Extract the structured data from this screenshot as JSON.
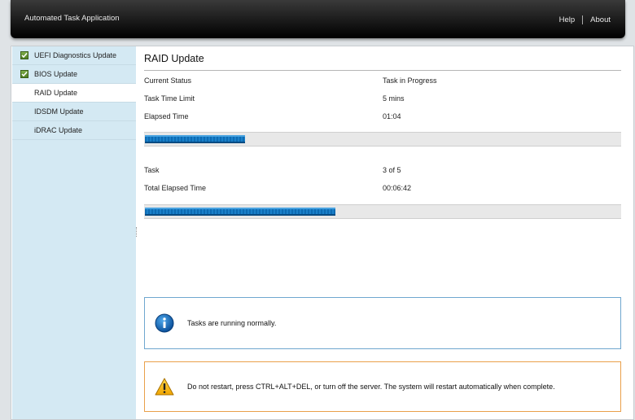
{
  "header": {
    "title": "Automated Task Application",
    "help_label": "Help",
    "about_label": "About"
  },
  "sidebar": {
    "items": [
      {
        "label": "UEFI Diagnostics Update",
        "status": "completed"
      },
      {
        "label": "BIOS Update",
        "status": "completed"
      },
      {
        "label": "RAID Update",
        "status": "active"
      },
      {
        "label": "IDSDM Update",
        "status": "pending"
      },
      {
        "label": "iDRAC Update",
        "status": "pending"
      }
    ]
  },
  "main": {
    "title": "RAID Update",
    "current_status_label": "Current Status",
    "current_status_value": "Task in Progress",
    "time_limit_label": "Task Time Limit",
    "time_limit_value": "5 mins",
    "elapsed_label": "Elapsed Time",
    "elapsed_value": "01:04",
    "task_progress_fraction": 0.21,
    "task_label": "Task",
    "task_value": "3 of 5",
    "total_elapsed_label": "Total Elapsed Time",
    "total_elapsed_value": "00:06:42",
    "overall_progress_fraction": 0.4
  },
  "messages": {
    "info_text": "Tasks are running normally.",
    "warning_text": "Do not restart, press CTRL+ALT+DEL, or turn off the server.  The system will restart automatically when complete."
  },
  "colors": {
    "accent_blue": "#0d6bb3",
    "sidebar_bg": "#d4e9f3",
    "warning_border": "#e9a04a",
    "info_border": "#6fa7cf"
  }
}
